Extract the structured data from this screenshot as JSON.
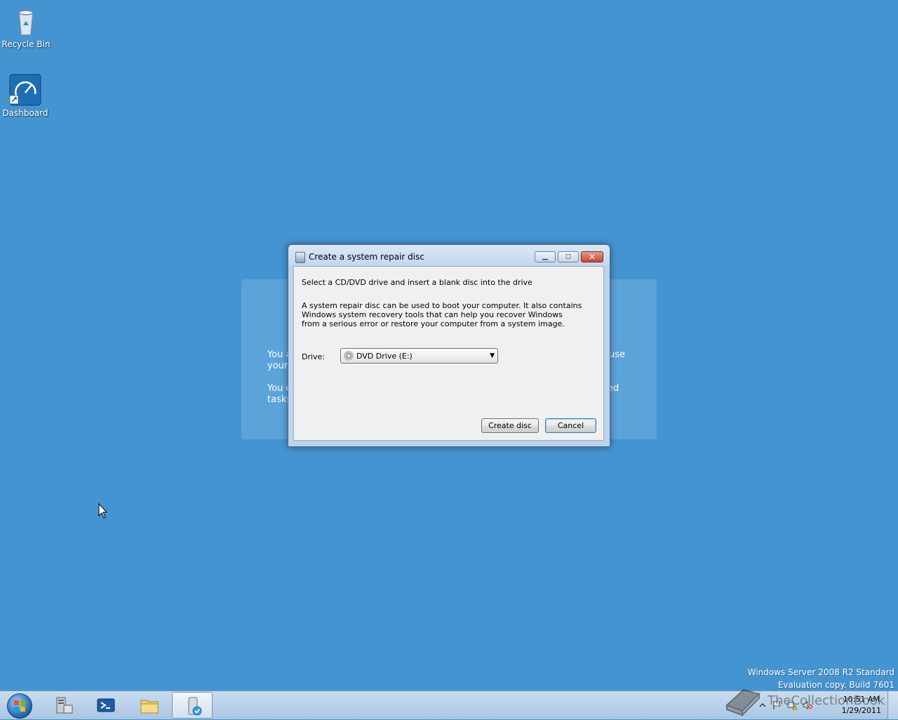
{
  "desktop": {
    "icons": [
      {
        "label": "Recycle Bin"
      },
      {
        "label": "Dashboard"
      }
    ]
  },
  "background_panel": {
    "line1_left": "You a",
    "line1_cont": "your",
    "line1_right": "use",
    "line2_left": "You c",
    "line2_cont": "tasks",
    "line2_right": "ed"
  },
  "dialog": {
    "title": "Create a system repair disc",
    "heading": "Select a CD/DVD drive and insert a blank disc into the drive",
    "description": "A system repair disc can be used to boot your computer. It also contains Windows system recovery tools that can help you recover Windows from a serious error or restore your computer from a system image.",
    "drive_label": "Drive:",
    "drive_value": "DVD Drive (E:)",
    "create_button": "Create disc",
    "cancel_button": "Cancel"
  },
  "watermark": {
    "line1": "Windows Server 2008 R2 Standard",
    "line2": "Evaluation copy. Build 7601"
  },
  "taskbar": {
    "clock_time": "10:51 AM",
    "clock_date": "1/29/2011"
  },
  "overlay": {
    "brand": "TheCollectionBook"
  },
  "colors": {
    "desktop": "#4594d2",
    "dialog_frame": "#bcd3ea",
    "close_button": "#c8452e"
  }
}
